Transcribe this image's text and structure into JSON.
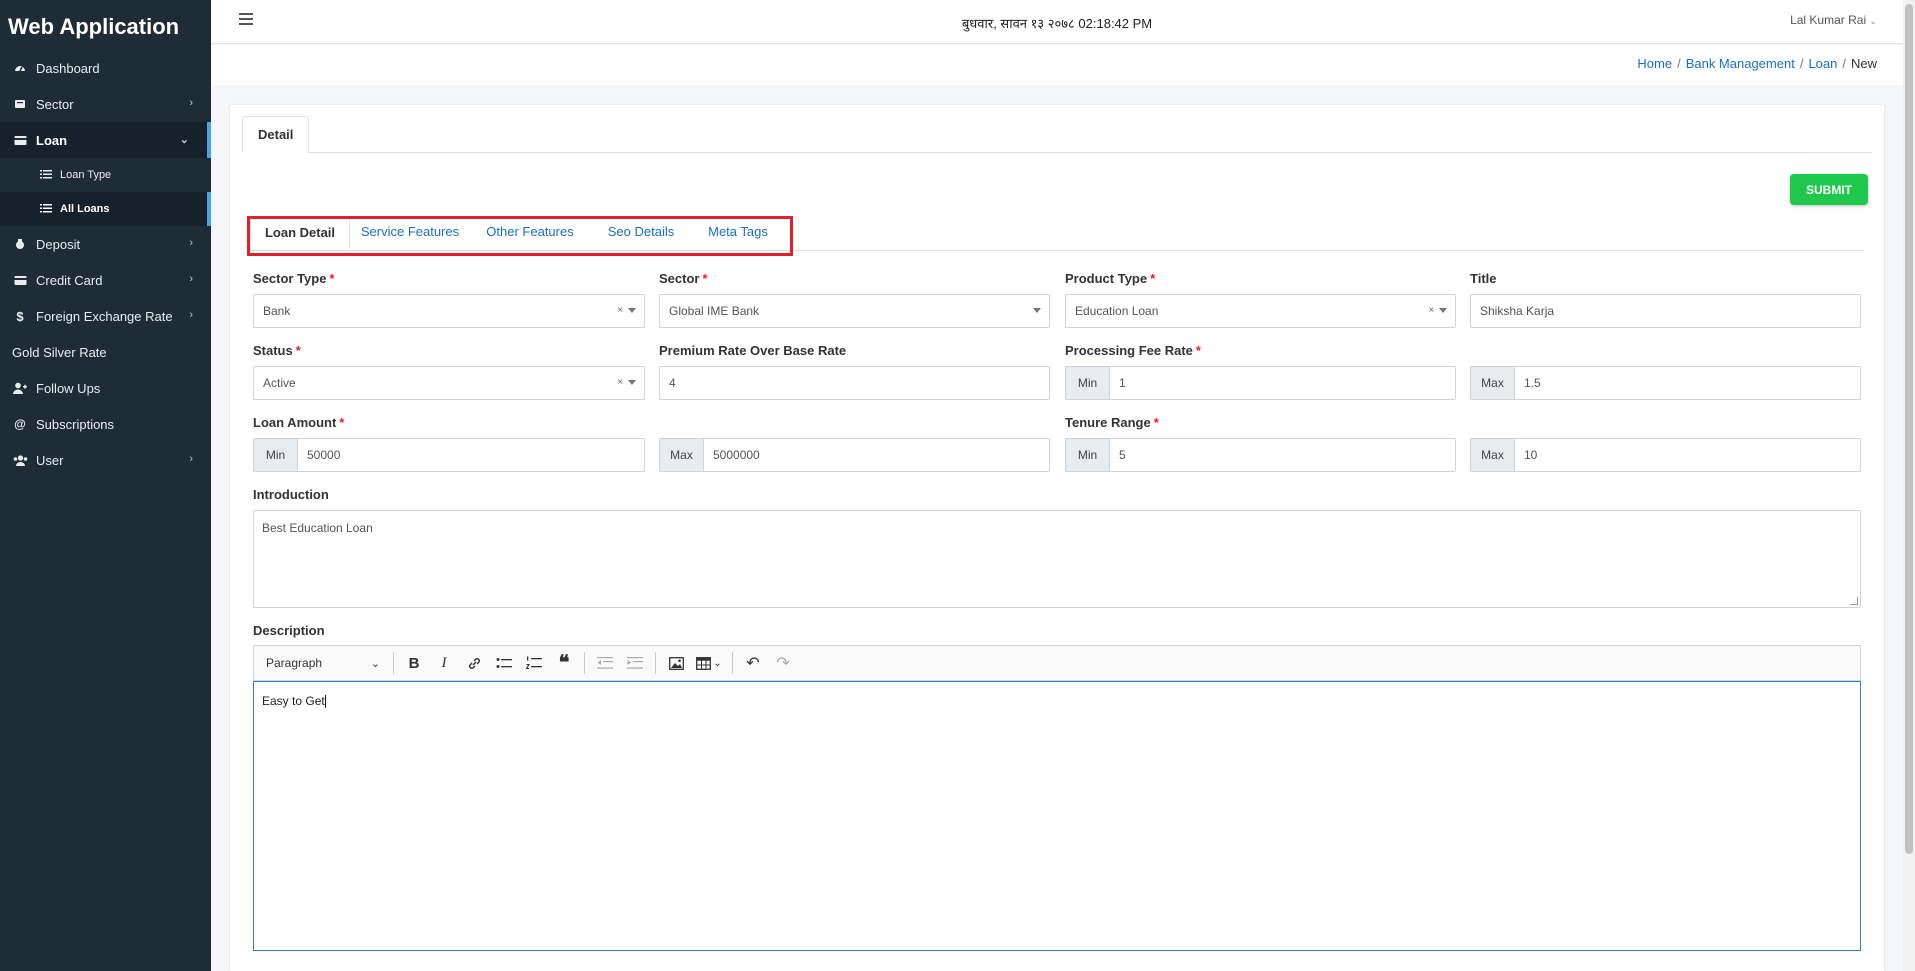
{
  "app": {
    "title": "Web Application"
  },
  "sidebar": {
    "items": [
      {
        "label": "Dashboard",
        "icon": "dashboard-icon"
      },
      {
        "label": "Sector",
        "icon": "sector-icon"
      },
      {
        "label": "Loan",
        "icon": "loan-icon"
      },
      {
        "label": "Deposit",
        "icon": "deposit-icon"
      },
      {
        "label": "Credit Card",
        "icon": "credit-card-icon"
      },
      {
        "label": "Foreign Exchange Rate",
        "icon": "dollar-icon"
      },
      {
        "label": "Gold Silver Rate",
        "icon": ""
      },
      {
        "label": "Follow Ups",
        "icon": "user-plus-icon"
      },
      {
        "label": "Subscriptions",
        "icon": "at-icon"
      },
      {
        "label": "User",
        "icon": "users-icon"
      }
    ],
    "loan_sub": [
      {
        "label": "Loan Type",
        "icon": "list-icon"
      },
      {
        "label": "All Loans",
        "icon": "list-icon"
      }
    ]
  },
  "header": {
    "datetime": "बुधवार, सावन १३ २०७८ 02:18:42 PM",
    "user": "Lal Kumar Rai"
  },
  "breadcrumb": [
    "Home",
    "Bank Management",
    "Loan",
    "New"
  ],
  "card": {
    "tab": "Detail",
    "submit_label": "SUBMIT"
  },
  "inner_tabs": [
    "Loan Detail",
    "Service Features",
    "Other Features",
    "Seo Details",
    "Meta Tags"
  ],
  "form": {
    "sector_type": {
      "label": "Sector Type",
      "value": "Bank"
    },
    "sector": {
      "label": "Sector",
      "value": "Global IME Bank"
    },
    "product_type": {
      "label": "Product Type",
      "value": "Education Loan"
    },
    "title": {
      "label": "Title",
      "value": "Shiksha Karja"
    },
    "status": {
      "label": "Status",
      "value": "Active"
    },
    "premium_rate": {
      "label": "Premium Rate Over Base Rate",
      "value": "4"
    },
    "processing_fee": {
      "label": "Processing Fee Rate",
      "min": "1",
      "max": "1.5"
    },
    "loan_amount": {
      "label": "Loan Amount",
      "min": "50000",
      "max": "5000000"
    },
    "tenure": {
      "label": "Tenure Range",
      "min": "5",
      "max": "10"
    },
    "min_label": "Min",
    "max_label": "Max",
    "introduction": {
      "label": "Introduction",
      "value": "Best Education Loan"
    },
    "description": {
      "label": "Description",
      "value": "Easy to Get",
      "format": "Paragraph"
    }
  },
  "colors": {
    "sidebar_bg": "#1e2c36",
    "accent": "#1a6fc4",
    "submit": "#1ec84d",
    "highlight": "#e0202b"
  }
}
